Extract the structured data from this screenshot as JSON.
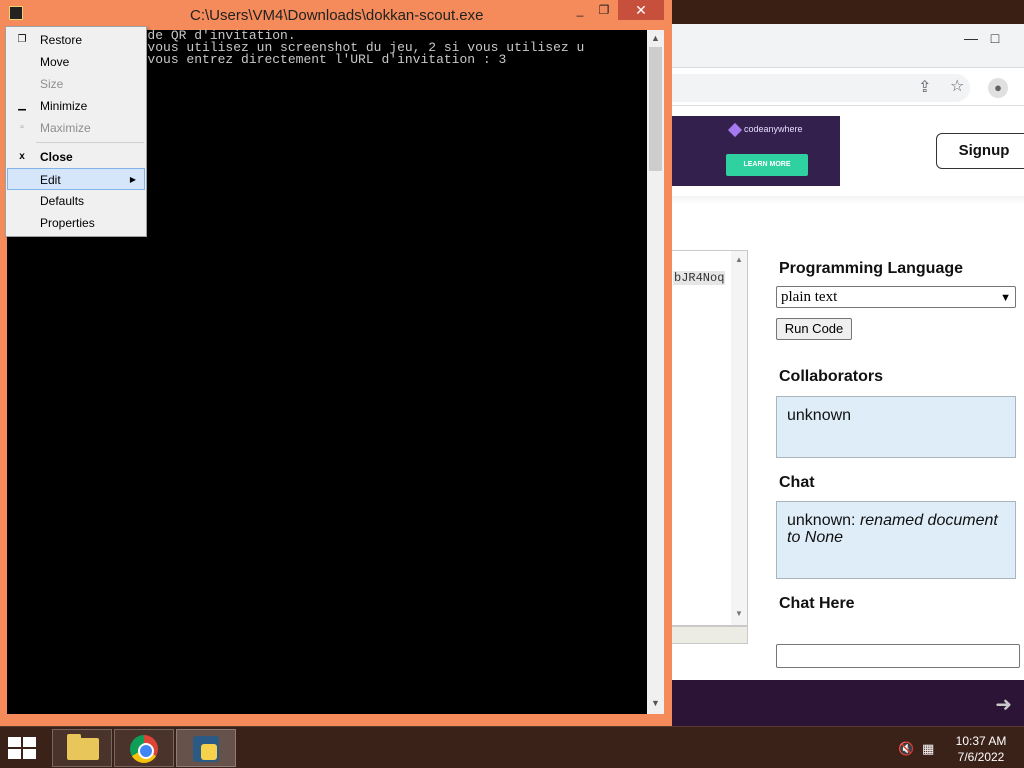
{
  "console": {
    "title": "C:\\Users\\VM4\\Downloads\\dokkan-scout.exe",
    "lines": [
      "           r le code QR d'invitation.",
      "           : 1 si vous utilisez un screenshot du jeu, 2 si vous utilisez u",
      "           : 3 si vous entrez directement l'URL d'invitation : 3"
    ]
  },
  "system_menu": {
    "items": [
      {
        "label": "Restore",
        "icon": "restore-icon"
      },
      {
        "label": "Move"
      },
      {
        "label": "Size"
      },
      {
        "label": "Minimize",
        "icon": "minimize-icon"
      },
      {
        "label": "Maximize",
        "icon": "maximize-icon"
      },
      {
        "label": "Close",
        "icon": "close-icon"
      },
      {
        "label": "Edit",
        "icon": "submenu-arrow-icon"
      },
      {
        "label": "Defaults"
      },
      {
        "label": "Properties"
      }
    ]
  },
  "browser": {
    "ad": {
      "brand": "codeanywhere",
      "button": "LEARN MORE"
    },
    "signup": "Signup",
    "code_snippet": "bJR4Noq",
    "programming_language": {
      "heading": "Programming Language",
      "selected": "plain text"
    },
    "run_code": "Run Code",
    "collaborators": {
      "heading": "Collaborators",
      "value": "unknown"
    },
    "chat": {
      "heading": "Chat",
      "user": "unknown:",
      "message": "renamed document to None"
    },
    "chat_here": {
      "heading": "Chat Here",
      "value": ""
    }
  },
  "taskbar": {
    "time": "10:37 AM",
    "date": "7/6/2022",
    "apps": [
      "file-explorer",
      "chrome",
      "python"
    ]
  }
}
